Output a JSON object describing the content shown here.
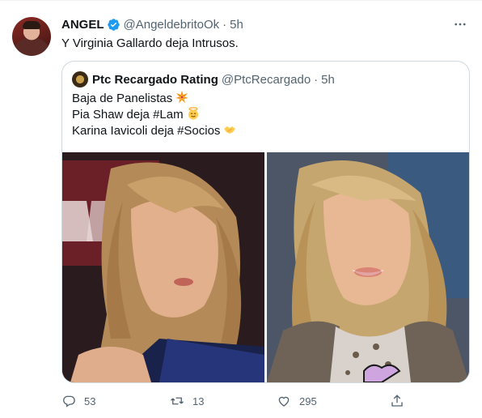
{
  "tweet": {
    "author_name": "ANGEL",
    "author_handle": "@AngeldebritoOk",
    "separator": "·",
    "time": "5h",
    "text": "Y Virginia Gallardo deja Intrusos."
  },
  "quoted": {
    "author_name": "Ptc Recargado Rating",
    "author_handle": "@PtcRecargado",
    "separator": "·",
    "time": "5h",
    "lines": [
      "Baja de Panelistas",
      "Pia Shaw deja #Lam",
      "Karina Iavicoli deja #Socios"
    ]
  },
  "actions": {
    "reply_count": "53",
    "retweet_count": "13",
    "like_count": "295"
  },
  "colors": {
    "accent": "#1d9bf0",
    "muted": "#536471",
    "text": "#0f1419",
    "border": "#cfd9de"
  },
  "icons": [
    "verified-badge-icon",
    "more-icon",
    "reply-icon",
    "retweet-icon",
    "like-icon",
    "share-icon",
    "collision-emoji",
    "angel-emoji",
    "handshake-emoji"
  ]
}
